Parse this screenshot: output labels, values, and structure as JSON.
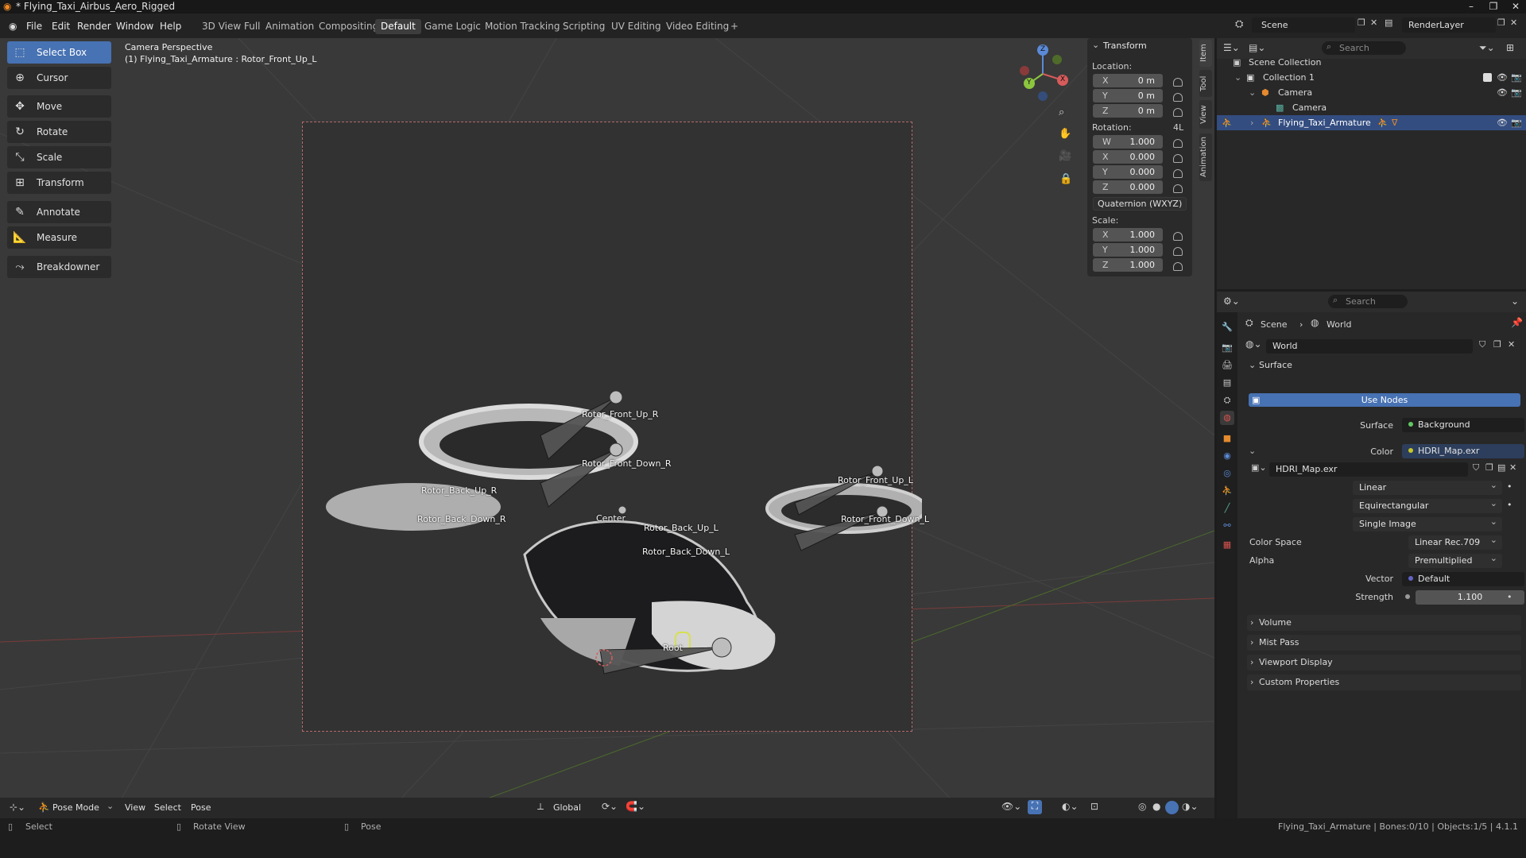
{
  "window": {
    "title": "* Flying_Taxi_Airbus_Aero_Rigged",
    "min": "–",
    "restore": "❐",
    "close": "✕"
  },
  "menu": {
    "file": "File",
    "edit": "Edit",
    "render": "Render",
    "window": "Window",
    "help": "Help"
  },
  "workspaces": [
    "3D View Full",
    "Animation",
    "Compositing",
    "Default",
    "Game Logic",
    "Motion Tracking",
    "Scripting",
    "UV Editing",
    "Video Editing",
    "+"
  ],
  "topright": {
    "scene": "Scene",
    "renderlayer": "RenderLayer"
  },
  "tools": [
    {
      "label": "Select Box",
      "icon": "select-box-icon",
      "glyph": "⬚"
    },
    {
      "label": "Cursor",
      "icon": "cursor-icon",
      "glyph": "⊕"
    },
    {
      "label": "Move",
      "icon": "move-icon",
      "glyph": "✥"
    },
    {
      "label": "Rotate",
      "icon": "rotate-icon",
      "glyph": "↻"
    },
    {
      "label": "Scale",
      "icon": "scale-icon",
      "glyph": "⤡"
    },
    {
      "label": "Transform",
      "icon": "transform-icon",
      "glyph": "⊞"
    },
    {
      "label": "Annotate",
      "icon": "annotate-icon",
      "glyph": "✎"
    },
    {
      "label": "Measure",
      "icon": "measure-icon",
      "glyph": "📐"
    },
    {
      "label": "Breakdowner",
      "icon": "breakdowner-icon",
      "glyph": "⤳"
    }
  ],
  "viewport": {
    "camera": "Camera Perspective",
    "active": "(1) Flying_Taxi_Armature : Rotor_Front_Up_L",
    "bones": [
      "Rotor_Front_Up_R",
      "Rotor_Front_Down_R",
      "Rotor_Back_Up_R",
      "Rotor_Back_Down_R",
      "Center",
      "Rotor_Back_Up_L",
      "Rotor_Back_Down_L",
      "Rotor_Front_Up_L",
      "Rotor_Front_Down_L",
      "Root"
    ],
    "gizmo": {
      "z": "Z",
      "x": "X",
      "y": "Y"
    }
  },
  "npanel": {
    "title": "Transform",
    "location_label": "Location:",
    "location": [
      {
        "axis": "X",
        "value": "0 m"
      },
      {
        "axis": "Y",
        "value": "0 m"
      },
      {
        "axis": "Z",
        "value": "0 m"
      }
    ],
    "rotation_label": "Rotation:",
    "rotation_flag": "4L",
    "rotation": [
      {
        "axis": "W",
        "value": "1.000"
      },
      {
        "axis": "X",
        "value": "0.000"
      },
      {
        "axis": "Y",
        "value": "0.000"
      },
      {
        "axis": "Z",
        "value": "0.000"
      }
    ],
    "rotation_mode": "Quaternion (WXYZ)",
    "scale_label": "Scale:",
    "scale": [
      {
        "axis": "X",
        "value": "1.000"
      },
      {
        "axis": "Y",
        "value": "1.000"
      },
      {
        "axis": "Z",
        "value": "1.000"
      }
    ],
    "tabs": [
      "Item",
      "Tool",
      "View",
      "Animation"
    ]
  },
  "vheader": {
    "mode": "Pose Mode",
    "view": "View",
    "select": "Select",
    "pose": "Pose",
    "orientation": "Global"
  },
  "status": {
    "select": "Select",
    "rotate": "Rotate View",
    "pose": "Pose",
    "info": "Flying_Taxi_Armature | Bones:0/10 | Objects:1/5 | 4.1.1"
  },
  "outliner": {
    "search": "Search",
    "rows": [
      {
        "label": "Scene Collection"
      },
      {
        "label": "Collection 1"
      },
      {
        "label": "Camera"
      },
      {
        "label": "Camera"
      },
      {
        "label": "Flying_Taxi_Armature"
      }
    ]
  },
  "props": {
    "search": "Search",
    "crumb_scene": "Scene",
    "crumb_world": "World",
    "world_name": "World",
    "surface_section": "Surface",
    "use_nodes": "Use Nodes",
    "surface_label": "Surface",
    "surface_value": "Background",
    "color_label": "Color",
    "color_value": "HDRI_Map.exr",
    "image_name": "HDRI_Map.exr",
    "interp": "Linear",
    "projection": "Equirectangular",
    "source": "Single Image",
    "colorspace_label": "Color Space",
    "colorspace_value": "Linear Rec.709",
    "alpha_label": "Alpha",
    "alpha_value": "Premultiplied",
    "vector_label": "Vector",
    "vector_value": "Default",
    "strength_label": "Strength",
    "strength_value": "1.100",
    "sections": [
      "Volume",
      "Mist Pass",
      "Viewport Display",
      "Custom Properties"
    ]
  },
  "colors": {
    "accent": "#4772b3",
    "selected_row": "#334d80",
    "surface_dot": "#63c763",
    "color_dot": "#c7c729",
    "vector_dot": "#6363c7"
  }
}
